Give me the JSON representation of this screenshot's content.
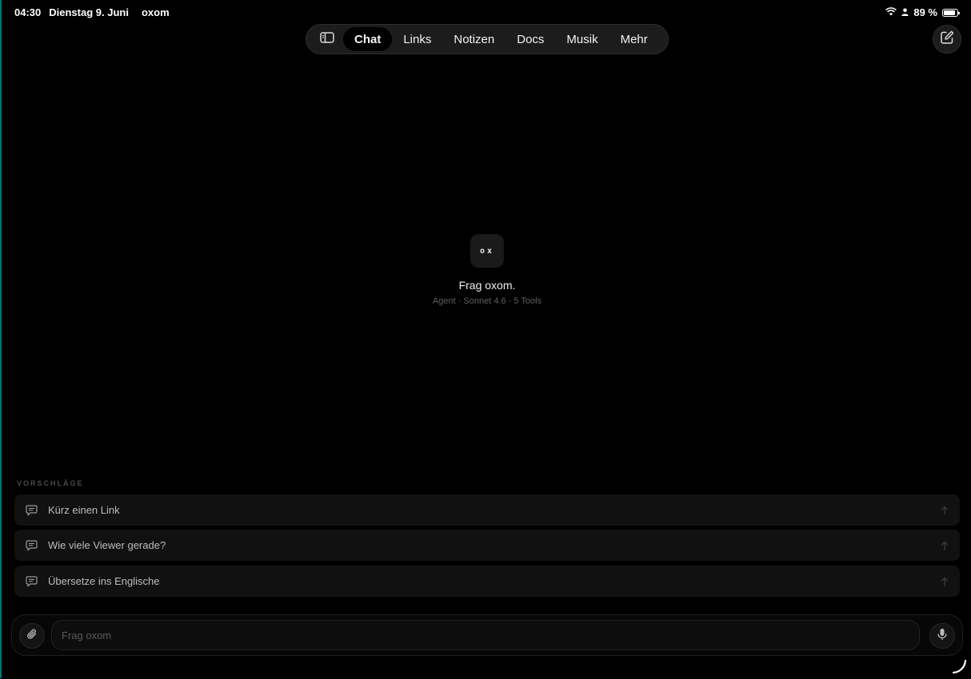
{
  "status_bar": {
    "time": "04:30",
    "date": "Dienstag 9. Juni",
    "carrier": "oxom",
    "battery_text": "89 %",
    "battery_level": 0.89
  },
  "nav": {
    "tabs": [
      {
        "label": "Chat",
        "active": true
      },
      {
        "label": "Links"
      },
      {
        "label": "Notizen"
      },
      {
        "label": "Docs"
      },
      {
        "label": "Musik"
      },
      {
        "label": "Mehr"
      }
    ]
  },
  "hero": {
    "logo_text": "ox",
    "title": "Frag oxom.",
    "subtitle": "Agent · Sonnet 4.6 · 5 Tools"
  },
  "suggestions": {
    "label": "VORSCHLÄGE",
    "items": [
      {
        "text": "Kürz einen Link"
      },
      {
        "text": "Wie viele Viewer gerade?"
      },
      {
        "text": "Übersetze ins Englische"
      }
    ]
  },
  "composer": {
    "placeholder": "Frag oxom",
    "value": ""
  },
  "colors": {
    "background": "#000000",
    "surface": "#1c1c1c",
    "accent_edge": "#0a6f6f"
  }
}
